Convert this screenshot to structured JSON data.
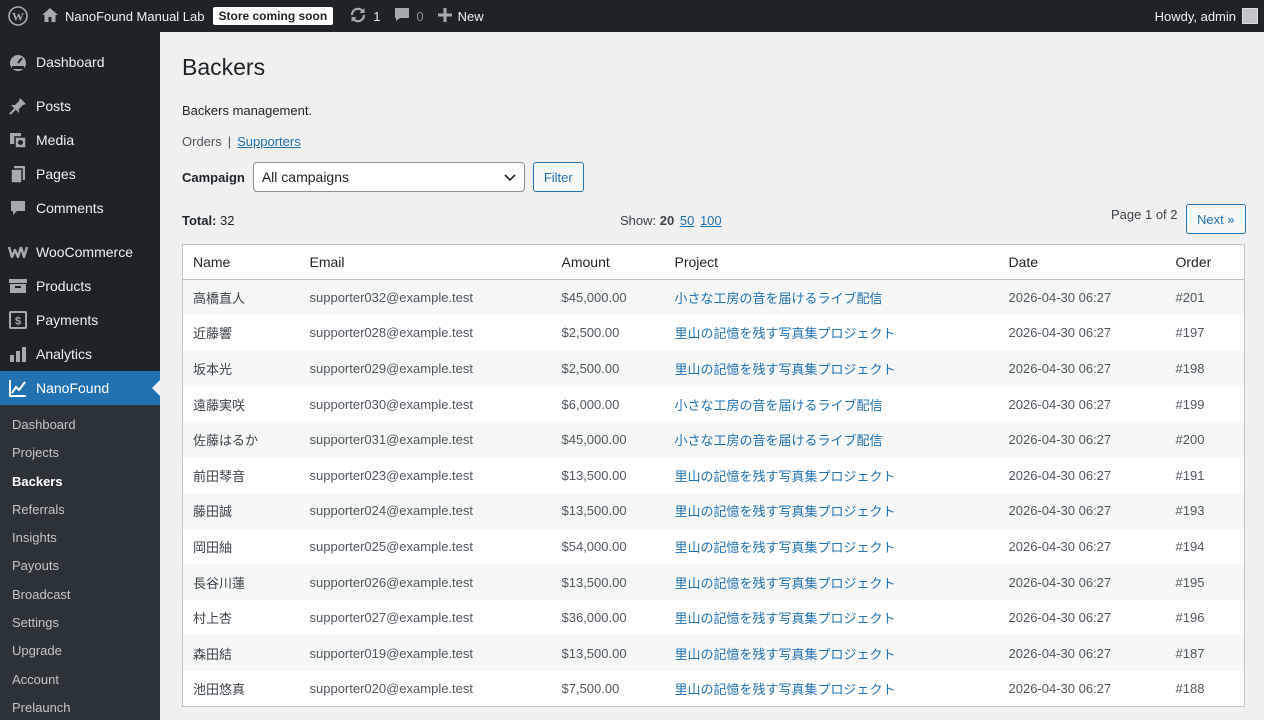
{
  "adminbar": {
    "site_name": "NanoFound Manual Lab",
    "store_badge": "Store coming soon",
    "updates_count": "1",
    "comments_count": "0",
    "new_label": "New",
    "howdy": "Howdy, admin"
  },
  "sidebar": {
    "menu": [
      {
        "label": "Dashboard",
        "icon": "dashboard-icon"
      },
      {
        "label": "Posts",
        "icon": "pin-icon"
      },
      {
        "label": "Media",
        "icon": "media-icon"
      },
      {
        "label": "Pages",
        "icon": "pages-icon"
      },
      {
        "label": "Comments",
        "icon": "comment-icon"
      },
      {
        "label": "WooCommerce",
        "icon": "woocommerce-icon"
      },
      {
        "label": "Products",
        "icon": "archive-icon"
      },
      {
        "label": "Payments",
        "icon": "dollar-icon"
      },
      {
        "label": "Analytics",
        "icon": "bar-chart-icon"
      },
      {
        "label": "NanoFound",
        "icon": "chart-line-icon"
      }
    ],
    "submenu": [
      "Dashboard",
      "Projects",
      "Backers",
      "Referrals",
      "Insights",
      "Payouts",
      "Broadcast",
      "Settings",
      "Upgrade",
      "Account",
      "Prelaunch"
    ]
  },
  "page": {
    "title": "Backers",
    "description": "Backers management.",
    "view_orders": "Orders",
    "view_separator": "|",
    "view_supporters": "Supporters",
    "campaign_label": "Campaign",
    "campaign_selected": "All campaigns",
    "filter_button": "Filter",
    "total_label": "Total:",
    "total_value": "32",
    "show_label": "Show:",
    "show_options": [
      "20",
      "50",
      "100"
    ],
    "page_info": "Page 1 of 2",
    "next_button": "Next »"
  },
  "table": {
    "columns": [
      "Name",
      "Email",
      "Amount",
      "Project",
      "Date",
      "Order"
    ],
    "rows": [
      [
        "高橋直人",
        "supporter032@example.test",
        "$45,000.00",
        "小さな工房の音を届けるライブ配信",
        "2026-04-30 06:27",
        "#201"
      ],
      [
        "近藤響",
        "supporter028@example.test",
        "$2,500.00",
        "里山の記憶を残す写真集プロジェクト",
        "2026-04-30 06:27",
        "#197"
      ],
      [
        "坂本光",
        "supporter029@example.test",
        "$2,500.00",
        "里山の記憶を残す写真集プロジェクト",
        "2026-04-30 06:27",
        "#198"
      ],
      [
        "遠藤実咲",
        "supporter030@example.test",
        "$6,000.00",
        "小さな工房の音を届けるライブ配信",
        "2026-04-30 06:27",
        "#199"
      ],
      [
        "佐藤はるか",
        "supporter031@example.test",
        "$45,000.00",
        "小さな工房の音を届けるライブ配信",
        "2026-04-30 06:27",
        "#200"
      ],
      [
        "前田琴音",
        "supporter023@example.test",
        "$13,500.00",
        "里山の記憶を残す写真集プロジェクト",
        "2026-04-30 06:27",
        "#191"
      ],
      [
        "藤田誠",
        "supporter024@example.test",
        "$13,500.00",
        "里山の記憶を残す写真集プロジェクト",
        "2026-04-30 06:27",
        "#193"
      ],
      [
        "岡田紬",
        "supporter025@example.test",
        "$54,000.00",
        "里山の記憶を残す写真集プロジェクト",
        "2026-04-30 06:27",
        "#194"
      ],
      [
        "長谷川蓮",
        "supporter026@example.test",
        "$13,500.00",
        "里山の記憶を残す写真集プロジェクト",
        "2026-04-30 06:27",
        "#195"
      ],
      [
        "村上杏",
        "supporter027@example.test",
        "$36,000.00",
        "里山の記憶を残す写真集プロジェクト",
        "2026-04-30 06:27",
        "#196"
      ],
      [
        "森田結",
        "supporter019@example.test",
        "$13,500.00",
        "里山の記憶を残す写真集プロジェクト",
        "2026-04-30 06:27",
        "#187"
      ],
      [
        "池田悠真",
        "supporter020@example.test",
        "$7,500.00",
        "里山の記憶を残す写真集プロジェクト",
        "2026-04-30 06:27",
        "#188"
      ]
    ]
  }
}
